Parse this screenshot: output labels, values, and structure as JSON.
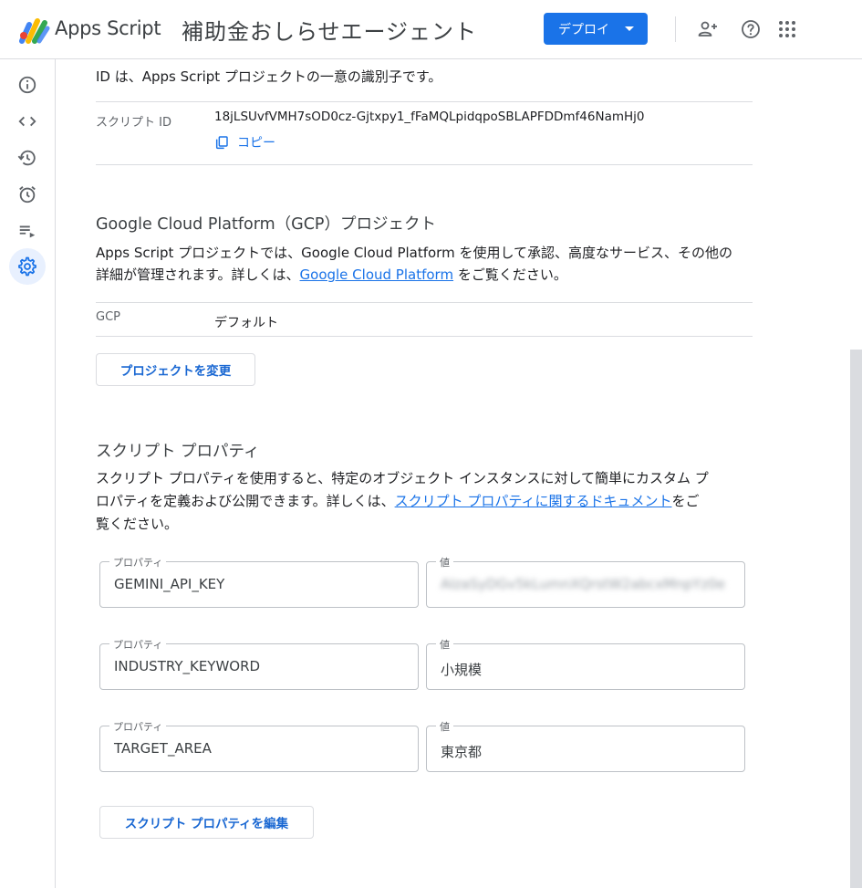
{
  "header": {
    "brand": "Apps Script",
    "project_title": "補助金おしらせエージェント",
    "deploy_label": "デプロイ"
  },
  "icons": {
    "add_person": "person-add-icon",
    "help": "help-icon",
    "apps": "apps-grid-icon"
  },
  "colors": {
    "accent": "#1a73e8",
    "link": "#1a73e8",
    "active_nav_bg": "#e8f0fe"
  },
  "sidebar": {
    "items": [
      {
        "name": "overview",
        "icon": "info-icon"
      },
      {
        "name": "editor",
        "icon": "code-icon"
      },
      {
        "name": "history",
        "icon": "history-icon"
      },
      {
        "name": "triggers",
        "icon": "alarm-icon"
      },
      {
        "name": "executions",
        "icon": "executions-icon"
      },
      {
        "name": "settings",
        "icon": "gear-icon",
        "active": true
      }
    ]
  },
  "ids": {
    "intro": "ID は、Apps Script プロジェクトの一意の識別子です。",
    "script_id_label": "スクリプト ID",
    "script_id_value": "18jLSUvfVMH7sOD0cz-Gjtxpy1_fFaMQLpidqpoSBLAPFDDmf46NamHj0",
    "copy_label": "コピー"
  },
  "gcp": {
    "heading": "Google Cloud Platform（GCP）プロジェクト",
    "desc_line1": "Apps Script プロジェクトでは、Google Cloud Platform を使用して承認、高度なサービス、その他の",
    "desc_line2_pre": "詳細が管理されます。詳しくは、",
    "desc_link": "Google Cloud Platform",
    "desc_line2_post": " をご覧ください。",
    "label": "GCP",
    "value": "デフォルト",
    "change_button": "プロジェクトを変更"
  },
  "props": {
    "heading": "スクリプト プロパティ",
    "desc_line1": "スクリプト プロパティを使用すると、特定のオブジェクト インスタンスに対して簡単にカスタム プ",
    "desc_line2_pre": "ロパティを定義および公開できます。詳しくは、",
    "desc_link": "スクリプト プロパティに関するドキュメント",
    "desc_line2_post": "をご",
    "desc_line3": "覧ください。",
    "property_label": "プロパティ",
    "value_label": "値",
    "rows": [
      {
        "key": "GEMINI_API_KEY",
        "value": "AIzaSyDGv5kLumnXQrstW2abcxMnpYz0e",
        "masked": true
      },
      {
        "key": "INDUSTRY_KEYWORD",
        "value": "小規模"
      },
      {
        "key": "TARGET_AREA",
        "value": "東京都"
      }
    ],
    "edit_button": "スクリプト プロパティを編集"
  }
}
